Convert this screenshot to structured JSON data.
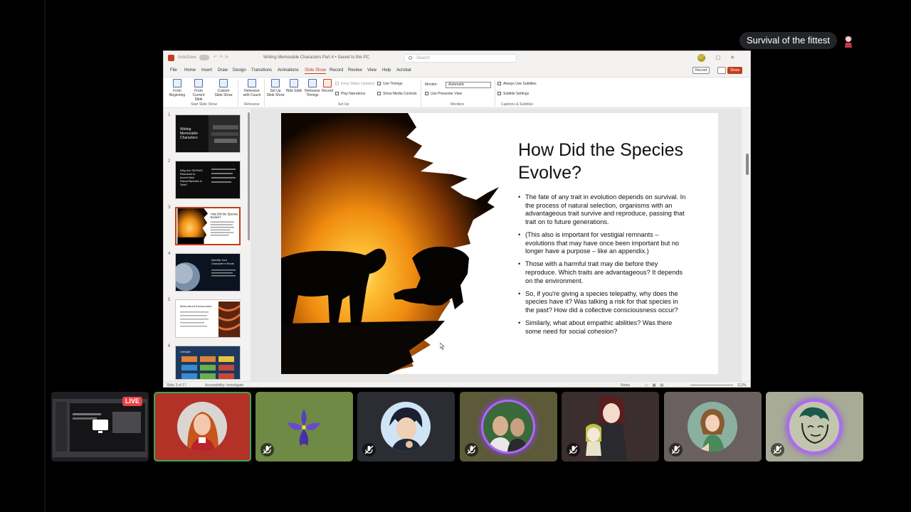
{
  "call": {
    "channel_name": "Survival of the fittest",
    "live_label": "LIVE"
  },
  "powerpoint": {
    "titlebar": {
      "autosave": "AutoSave",
      "document_name": "Writing Memorable Characters Part 4 • Saved to this PC",
      "search_placeholder": "Search",
      "user_initials": "CC"
    },
    "tabs": [
      "File",
      "Home",
      "Insert",
      "Draw",
      "Design",
      "Transitions",
      "Animations",
      "Slide Show",
      "Record",
      "Review",
      "View",
      "Help",
      "Acrobat"
    ],
    "active_tab": "Slide Show",
    "record_button": "Record",
    "share_button": "Share",
    "ribbon": {
      "from_beginning": "From Beginning",
      "from_current": "From Current Slide",
      "custom_show": "Custom Slide Show",
      "group_start": "Start Slide Show",
      "rehearse_coach": "Rehearse with Coach",
      "group_rehearse": "Rehearse",
      "set_up": "Set Up Slide Show",
      "hide_slide": "Hide Slide",
      "rehearse_timings": "Rehearse Timings",
      "record": "Record",
      "keep_updated": "Keep Slides Updated",
      "play_narrations": "Play Narrations",
      "use_timings": "Use Timings",
      "show_media": "Show Media Controls",
      "group_setup": "Set Up",
      "monitor_label": "Monitor:",
      "monitor_value": "Automatic",
      "presenter_view": "Use Presenter View",
      "group_monitors": "Monitors",
      "always_subtitles": "Always Use Subtitles",
      "subtitle_settings": "Subtitle Settings",
      "group_captions": "Captions & Subtitles"
    },
    "thumbnails": {
      "numbers": [
        "1",
        "2",
        "3",
        "4",
        "5",
        "6"
      ],
      "t1_title": "Writing Memorable Characters",
      "t2_title": "Why Are SD/SNG Reluctant to Invent New Races/Species in Sets?",
      "t3_title": "How Did the Species Evolve?",
      "t4_title": "Identify Your Character's Roots",
      "t5_title": "Mess About Environment",
      "t6_title": "Lifestyle"
    },
    "slide": {
      "title": "How Did the Species Evolve?",
      "bullets": [
        "The fate of any trait in evolution depends on survival. In the process of natural selection, organisms with an advantageous trait survive and reproduce, passing that trait on to future generations.",
        "(This also is important for vestigial remnants – evolutions that may have once been important but no longer have a purpose – like an appendix.)",
        "Those with a harmful trait may die before they reproduce. Which traits are advantageous? It depends on the environment.",
        "So, if you're giving a species telepathy, why does the species have it? Was talking a risk for that species in the past? How did a collective consciousness occur?",
        "Similarly, what about empathic abilities? Was there some need for social cohesion?"
      ]
    },
    "statusbar": {
      "slide_info": "Slide 3 of 17",
      "accessibility": "Accessibility: Investigate",
      "notes": "Notes",
      "zoom": "113%"
    }
  },
  "colors": {
    "accent": "#c43e1c",
    "speaking": "#3ba55d",
    "live": "#ed4245",
    "ring": "#b266ff"
  }
}
